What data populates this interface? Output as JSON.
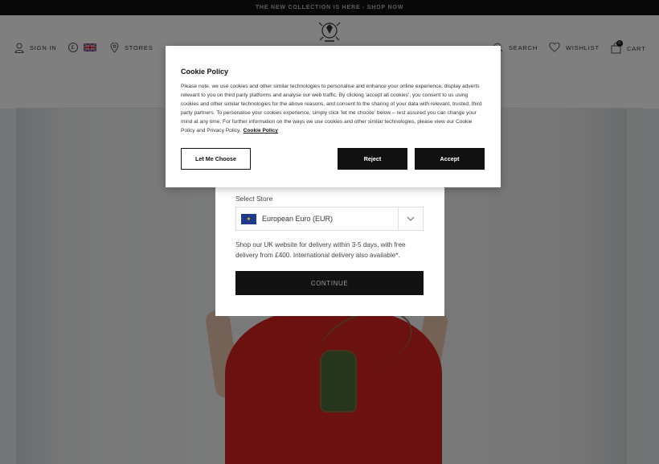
{
  "promo": {
    "text": "THE NEW COLLECTION IS HERE - SHOP NOW"
  },
  "header": {
    "sign_in": "SIGN IN",
    "currency_symbol": "£",
    "stores": "STORES",
    "search": "SEARCH",
    "wishlist": "WISHLIST",
    "cart": "CART",
    "cart_count": "0"
  },
  "store_modal": {
    "label": "Select Store",
    "selected": "European Euro (EUR)",
    "info": "Shop our UK website for delivery within 3-5 days, with free delivery from £400. International delivery also available*.",
    "continue": "CONTINUE"
  },
  "cookie": {
    "title": "Cookie Policy",
    "body": "Please note, we use cookies and other similar technologies to personalise and enhance your online experience, display adverts relevant to you on third party platforms and analyse our web traffic. By clicking 'accept all cookies', you consent to us using cookies and other similar technologies for the above reasons, and consent to the sharing of your data with relevant, trusted, third party partners. To personalise your cookies experience, simply click 'let me choose' below – rest assured you can change your mind at any time. For further information on the ways we use cookies and other similar technologies, please view our Cookie Policy and Privacy Policy.",
    "link": "Cookie Policy",
    "let_me_choose": "Let Me Choose",
    "reject": "Reject",
    "accept": "Accept"
  },
  "colors": {
    "promo_bg": "#111111",
    "button_dark": "#111111",
    "dress_red": "#d6221f"
  }
}
